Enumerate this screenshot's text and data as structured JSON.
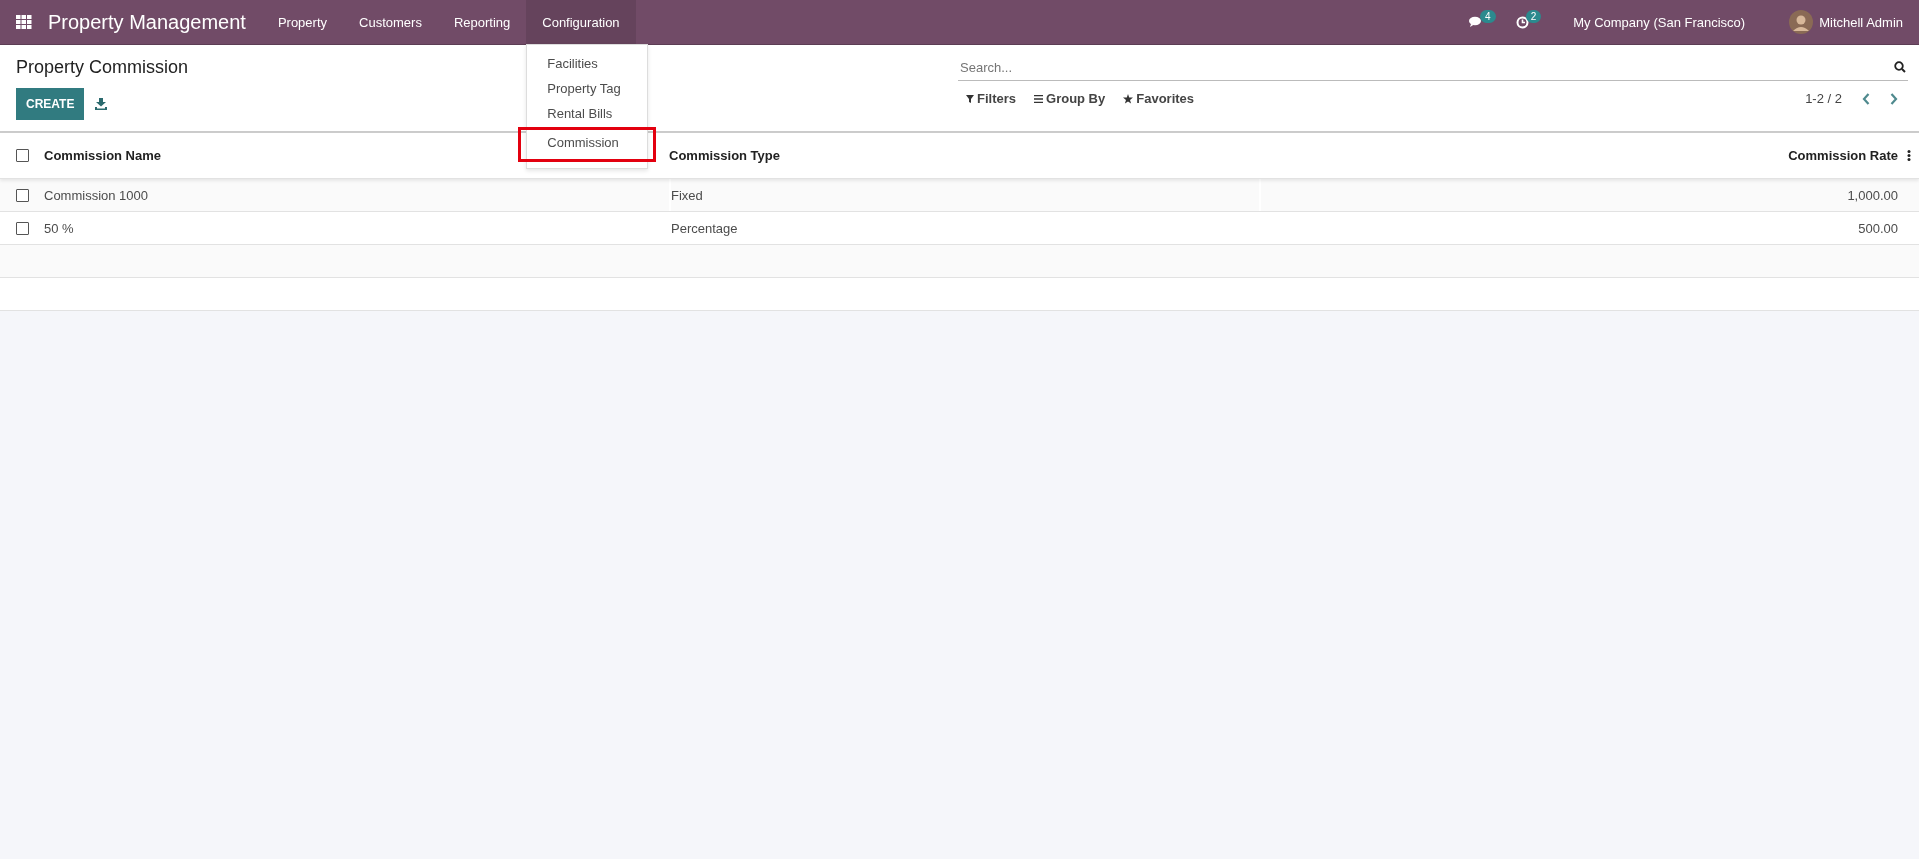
{
  "navbar": {
    "brand": "Property Management",
    "menus": [
      {
        "label": "Property",
        "selected": false
      },
      {
        "label": "Customers",
        "selected": false
      },
      {
        "label": "Reporting",
        "selected": false
      },
      {
        "label": "Configuration",
        "selected": true
      }
    ],
    "messages_count": "4",
    "activities_count": "2",
    "company": "My Company (San Francisco)",
    "user": "Mitchell Admin"
  },
  "dropdown": {
    "items": [
      {
        "label": "Facilities",
        "highlighted": false
      },
      {
        "label": "Property Tag",
        "highlighted": false
      },
      {
        "label": "Rental Bills",
        "highlighted": false
      },
      {
        "label": "Commission",
        "highlighted": true
      }
    ]
  },
  "control_panel": {
    "title": "Property Commission",
    "create_button": "CREATE",
    "search": {
      "placeholder": "Search..."
    },
    "filters": "Filters",
    "group_by": "Group By",
    "favorites": "Favorites",
    "pager": "1-2 / 2"
  },
  "table": {
    "columns": [
      "Commission Name",
      "Commission Type",
      "Commission Rate"
    ],
    "rows": [
      {
        "name": "Commission 1000",
        "type": "Fixed",
        "rate": "1,000.00",
        "checked": false
      },
      {
        "name": "50 %",
        "type": "Percentage",
        "rate": "500.00",
        "checked": false
      }
    ],
    "all_checked": false
  }
}
